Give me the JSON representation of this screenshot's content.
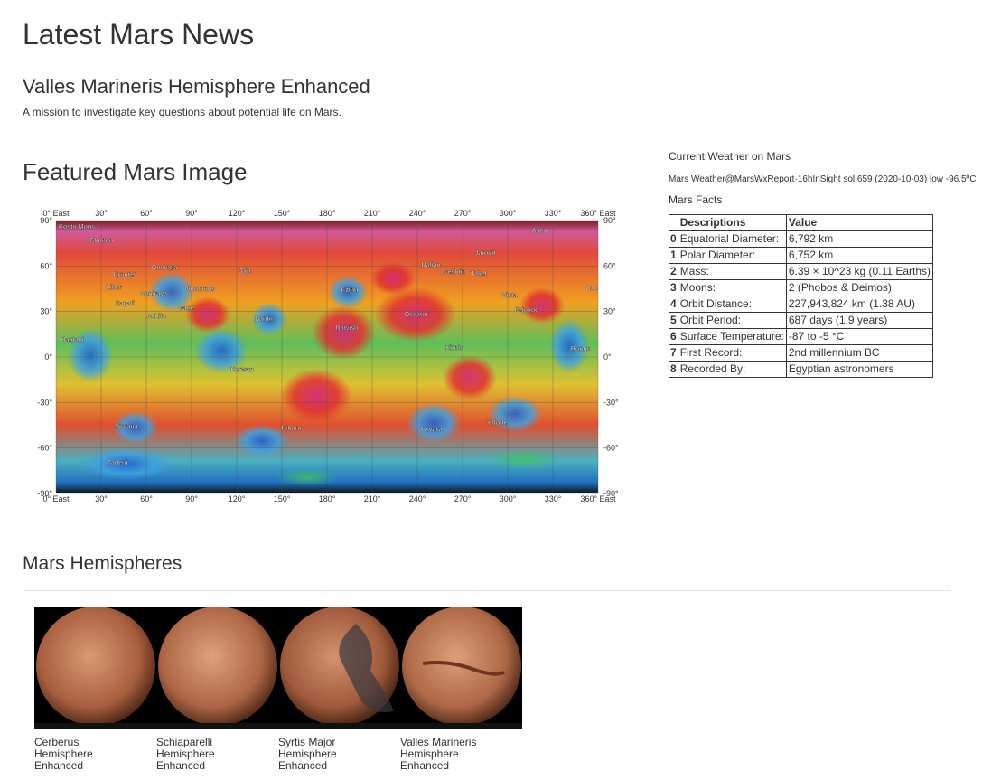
{
  "page_title": "Latest Mars News",
  "news": {
    "title": "Valles Marineris Hemisphere Enhanced",
    "paragraph": "A mission to investigate key questions about potential life on Mars."
  },
  "featured": {
    "title": "Featured Mars Image",
    "map": {
      "top_labels": [
        "0° East",
        "30°",
        "60°",
        "90°",
        "120°",
        "150°",
        "180°",
        "210°",
        "240°",
        "270°",
        "300°",
        "330°",
        "360° East"
      ],
      "bottom_labels": [
        "0° East",
        "30°",
        "60°",
        "90°",
        "120°",
        "150°",
        "180°",
        "210°",
        "240°",
        "270°",
        "300°",
        "330°",
        "360° East"
      ],
      "left_labels": [
        "90°",
        "60°",
        "30°",
        "0°",
        "-30°",
        "-60°",
        "-90°"
      ],
      "right_labels": [
        "90°",
        "60°",
        "30°",
        "0°",
        "-30°",
        "-60°",
        "-90°"
      ],
      "features": [
        "Kosto Mons",
        "Ghanan",
        "Asari",
        "Jarovit",
        "Omonga",
        "Ernutet",
        "Liber",
        "Coniraya",
        "Ikapati",
        "Vinotonus",
        "Gaue",
        "Achita",
        "Jaja",
        "Dantu",
        "Ezinu",
        "Dalian",
        "Geshtin",
        "Takel",
        "Vista",
        "Oxo",
        "Fejokoo",
        "Occator",
        "Nawish",
        "Kirnis",
        "Hautani",
        "Rongo",
        "Kerwan",
        "Sintana",
        "Toharu",
        "Urvara",
        "Yalode",
        "Zadeni"
      ]
    }
  },
  "weather": {
    "heading": "Current Weather on Mars",
    "text": "Mars Weather@MarsWxReport·16hInSight sol 659 (2020-10-03) low -96.5ºC"
  },
  "facts": {
    "heading": "Mars Facts",
    "columns": [
      "Descriptions",
      "Value"
    ],
    "rows": [
      {
        "idx": "0",
        "desc": "Equatorial Diameter:",
        "value": "6,792 km"
      },
      {
        "idx": "1",
        "desc": "Polar Diameter:",
        "value": "6,752 km"
      },
      {
        "idx": "2",
        "desc": "Mass:",
        "value": "6.39 × 10^23 kg (0.11 Earths)"
      },
      {
        "idx": "3",
        "desc": "Moons:",
        "value": "2 (Phobos & Deimos)"
      },
      {
        "idx": "4",
        "desc": "Orbit Distance:",
        "value": "227,943,824 km (1.38 AU)"
      },
      {
        "idx": "5",
        "desc": "Orbit Period:",
        "value": "687 days (1.9 years)"
      },
      {
        "idx": "6",
        "desc": "Surface Temperature:",
        "value": "-87 to -5 °C"
      },
      {
        "idx": "7",
        "desc": "First Record:",
        "value": "2nd millennium BC"
      },
      {
        "idx": "8",
        "desc": "Recorded By:",
        "value": "Egyptian astronomers"
      }
    ]
  },
  "hemispheres": {
    "title": "Mars Hemispheres",
    "items": [
      {
        "caption": "Cerberus Hemisphere Enhanced",
        "color": "#c07a55"
      },
      {
        "caption": "Schiaparelli Hemisphere Enhanced",
        "color": "#c47f5b"
      },
      {
        "caption": "Syrtis Major Hemisphere Enhanced",
        "color": "#b56f4c"
      },
      {
        "caption": "Valles Marineris Hemisphere Enhanced",
        "color": "#c4825d"
      }
    ]
  },
  "colors": {
    "text": "#333333",
    "rule": "#e5e5e5",
    "strip_bg": "#000000"
  }
}
